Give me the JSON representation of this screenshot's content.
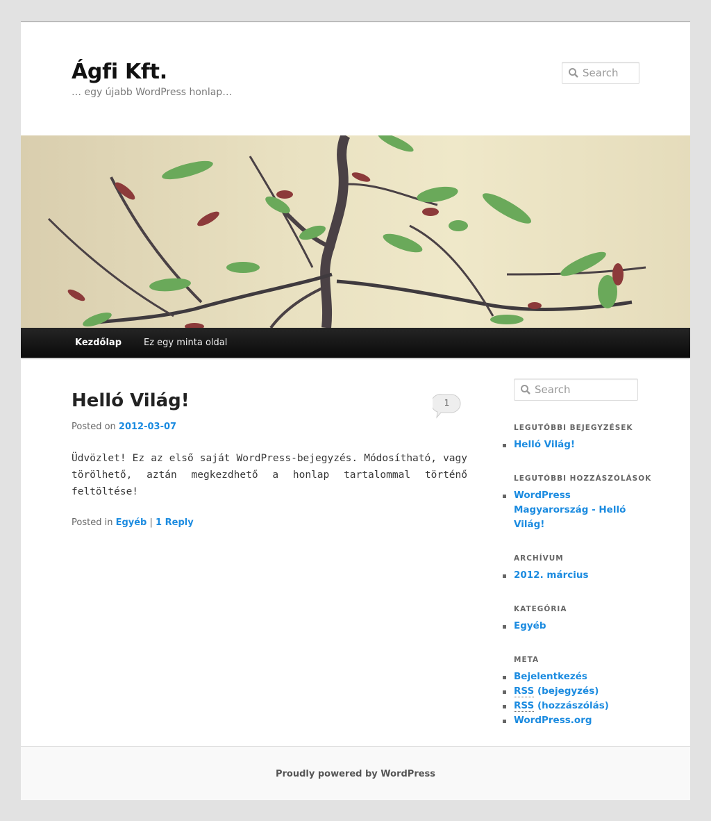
{
  "site": {
    "title": "Ágfi Kft.",
    "description": "… egy újabb WordPress honlap…",
    "search_placeholder": "Search"
  },
  "nav": {
    "items": [
      {
        "label": "Kezdőlap",
        "current": true
      },
      {
        "label": "Ez egy minta oldal",
        "current": false
      }
    ]
  },
  "post": {
    "title": "Helló Világ!",
    "comment_count": "1",
    "posted_on_label": "Posted on",
    "date": "2012-03-07",
    "content": "Üdvözlet! Ez az első saját WordPress-bejegyzés. Módosítható, vagy törölhető, aztán megkezdhető a honlap tartalommal történő feltöltése!",
    "posted_in_label": "Posted in",
    "category": "Egyéb",
    "separator": "|",
    "reply_label": "1 Reply"
  },
  "sidebar": {
    "search_placeholder": "Search",
    "recent_posts": {
      "title": "LEGUTÓBBI BEJEGYZÉSEK",
      "items": [
        "Helló Világ!"
      ]
    },
    "recent_comments": {
      "title": "LEGUTÓBBI HOZZÁSZÓLÁSOK",
      "items": [
        "WordPress Magyarország - Helló Világ!"
      ]
    },
    "archive": {
      "title": "ARCHÍVUM",
      "items": [
        "2012. március"
      ]
    },
    "categories": {
      "title": "KATEGÓRIA",
      "items": [
        "Egyéb"
      ]
    },
    "meta": {
      "title": "META",
      "login": "Bejelentkezés",
      "rss_abbr": "RSS",
      "rss_posts_suffix": " (bejegyzés)",
      "rss_comments_suffix": " (hozzászólás)",
      "wordpress_org": "WordPress.org"
    }
  },
  "footer": {
    "credit": "Proudly powered by WordPress"
  },
  "colors": {
    "link": "#1b8be0",
    "background": "#e2e2e2",
    "nav_background": "#111111"
  }
}
